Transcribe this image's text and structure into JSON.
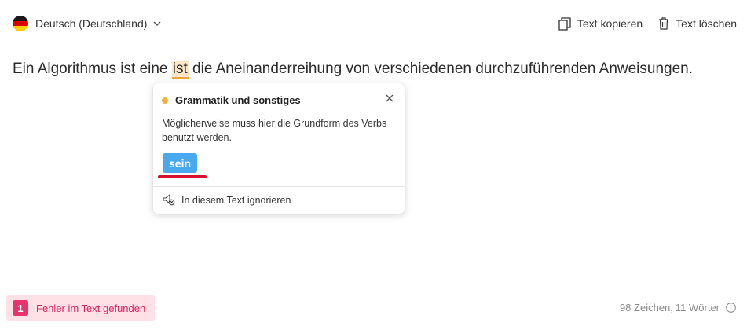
{
  "header": {
    "language_label": "Deutsch (Deutschland)",
    "copy_label": "Text kopieren",
    "delete_label": "Text löschen"
  },
  "editor": {
    "text_before": "Ein Algorithmus ist eine ",
    "error_word": "ist",
    "text_after": " die Aneinanderreihung von verschiedenen durchzuführenden Anweisungen."
  },
  "popover": {
    "category": "Grammatik und sonstiges",
    "message": "Möglicherweise muss hier die Grundform des Verbs benutzt werden.",
    "suggestion": "sein",
    "ignore_label": "In diesem Text ignorieren"
  },
  "footer": {
    "error_count": "1",
    "errors_label": "Fehler im Text gefunden",
    "chars_label": "98 Zeichen,",
    "words_label": "11 Wörter"
  },
  "colors": {
    "flag": [
      "#1a1a1a",
      "#dd0000",
      "#ffce00"
    ],
    "category_dot": "#f0b13d",
    "suggestion_bg": "#4aa8ee",
    "error_accent": "#e8336a"
  }
}
